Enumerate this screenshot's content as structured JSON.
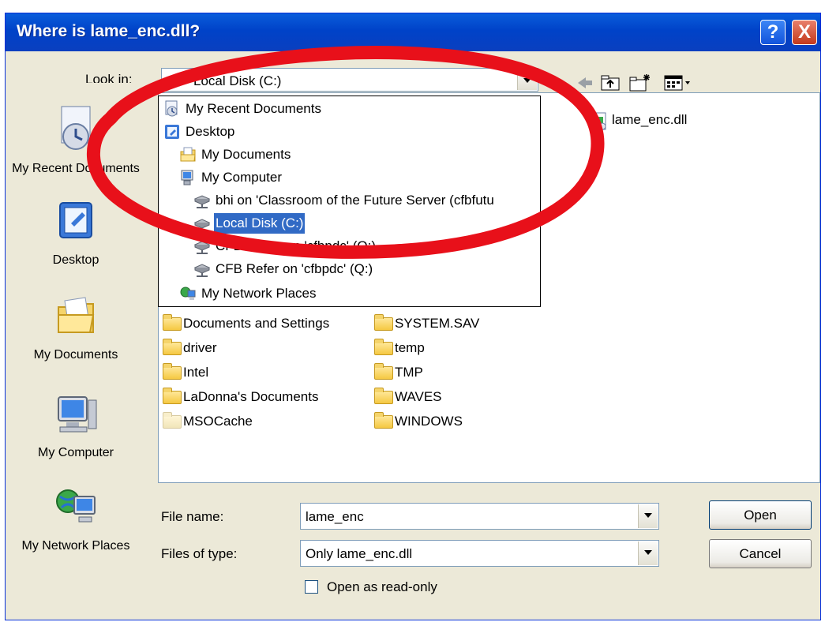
{
  "dialog": {
    "title": "Where is lame_enc.dll?",
    "help_label": "?",
    "close_label": "X"
  },
  "look_in": {
    "label": "Look in:",
    "value": "Local Disk (C:)"
  },
  "places": [
    {
      "label": "My Recent Documents",
      "icon": "recent-documents-icon"
    },
    {
      "label": "Desktop",
      "icon": "desktop-icon"
    },
    {
      "label": "My Documents",
      "icon": "my-documents-icon"
    },
    {
      "label": "My Computer",
      "icon": "my-computer-icon"
    },
    {
      "label": "My Network Places",
      "icon": "network-places-icon"
    }
  ],
  "dropdown_items": [
    {
      "label": "My Recent Documents",
      "icon": "recent-documents-icon"
    },
    {
      "label": "Desktop",
      "icon": "desktop-icon"
    },
    {
      "label": "My Documents",
      "icon": "my-documents-icon"
    },
    {
      "label": "My Computer",
      "icon": "my-computer-icon"
    },
    {
      "label": "bhi on 'Classroom of the Future Server (cfbfutu",
      "icon": "network-drive-icon"
    },
    {
      "label": "Local Disk (C:)",
      "icon": "local-disk-icon",
      "selected": true
    },
    {
      "label": "CFB Share on 'cfbpdc' (O:)",
      "icon": "network-drive-icon"
    },
    {
      "label": "CFB Refer on 'cfbpdc' (Q:)",
      "icon": "network-drive-icon"
    },
    {
      "label": "My Network Places",
      "icon": "network-places-icon"
    }
  ],
  "files": {
    "top_file": "lame_enc.dll",
    "col1": [
      "Documents and Settings",
      "driver",
      "Intel",
      "LaDonna's Documents",
      "MSOCache"
    ],
    "col2": [
      "SYSTEM.SAV",
      "temp",
      "TMP",
      "WAVES",
      "WINDOWS"
    ]
  },
  "file_name": {
    "label": "File name:",
    "value": "lame_enc"
  },
  "file_type": {
    "label": "Files of type:",
    "value": "Only lame_enc.dll"
  },
  "read_only": {
    "label": "Open as read-only"
  },
  "buttons": {
    "open": "Open",
    "cancel": "Cancel"
  },
  "colors": {
    "title_bar": "#0042c8",
    "selection": "#316ac5",
    "annotation": "#e8101a"
  }
}
